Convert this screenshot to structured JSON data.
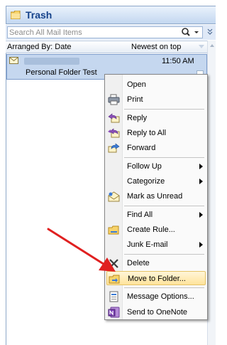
{
  "folder": {
    "title": "Trash"
  },
  "search": {
    "placeholder": "Search All Mail Items"
  },
  "arrange": {
    "label": "Arranged By: Date",
    "sort": "Newest on top"
  },
  "mail_item": {
    "time": "11:50 AM",
    "subject": "Personal Folder Test"
  },
  "context_menu": {
    "items": [
      {
        "label": "Open",
        "icon": "open"
      },
      {
        "label": "Print",
        "icon": "printer-icon"
      },
      {
        "label": "Reply",
        "icon": "reply-icon"
      },
      {
        "label": "Reply to All",
        "icon": "reply-all-icon"
      },
      {
        "label": "Forward",
        "icon": "forward-icon"
      },
      {
        "label": "Follow Up",
        "submenu": true
      },
      {
        "label": "Categorize",
        "submenu": true
      },
      {
        "label": "Mark as Unread",
        "icon": "envelope-open-icon"
      },
      {
        "label": "Find All",
        "submenu": true
      },
      {
        "label": "Create Rule...",
        "icon": "rule-icon"
      },
      {
        "label": "Junk E-mail",
        "submenu": true
      },
      {
        "label": "Delete",
        "icon": "delete-x-icon"
      },
      {
        "label": "Move to Folder...",
        "icon": "move-folder-icon",
        "highlighted": true
      },
      {
        "label": "Message Options...",
        "icon": "options-icon"
      },
      {
        "label": "Send to OneNote",
        "icon": "onenote-icon"
      }
    ]
  },
  "colors": {
    "title_text": "#15428b",
    "selection": "#c5d7ef",
    "highlight": "#ffe39b",
    "arrow": "#e02020"
  }
}
